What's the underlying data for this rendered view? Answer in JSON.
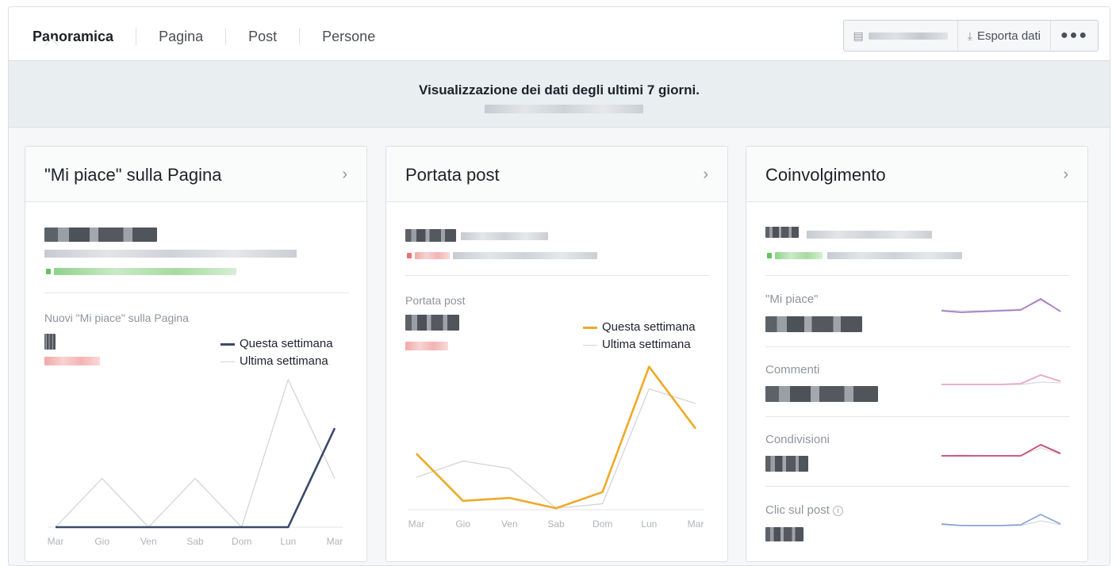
{
  "tabs": [
    {
      "label": "Panoramica",
      "active": true
    },
    {
      "label": "Pagina",
      "active": false
    },
    {
      "label": "Post",
      "active": false
    },
    {
      "label": "Persone",
      "active": false
    }
  ],
  "toolbar": {
    "date_icon": "calendar-icon",
    "export_label": "Esporta dati",
    "export_icon": "download-icon",
    "more_label": "●●●"
  },
  "banner": {
    "title": "Visualizzazione dei dati degli ultimi 7 giorni."
  },
  "cards": {
    "likes": {
      "title": "\"Mi piace\" sulla Pagina",
      "chart_label": "Nuovi \"Mi piace\" sulla Pagina",
      "legend_this": "Questa settimana",
      "legend_last": "Ultima settimana"
    },
    "reach": {
      "title": "Portata post",
      "chart_label": "Portata post",
      "legend_this": "Questa settimana",
      "legend_last": "Ultima settimana"
    },
    "engagement": {
      "title": "Coinvolgimento",
      "rows": [
        {
          "label": "\"Mi piace\"",
          "color": "#a77bc4"
        },
        {
          "label": "Commenti",
          "color": "#e8a6c8"
        },
        {
          "label": "Condivisioni",
          "color": "#c6486f"
        },
        {
          "label": "Clic sul post",
          "color": "#8ea3d8"
        }
      ]
    }
  },
  "colors": {
    "likes_this_week": "#3b4a6b",
    "reach_this_week": "#f0a92b",
    "last_week": "#d3d5d9"
  },
  "chart_data": [
    {
      "type": "line",
      "title": "Nuovi \"Mi piace\" sulla Pagina",
      "categories": [
        "Mar",
        "Gio",
        "Ven",
        "Sab",
        "Dom",
        "Lun",
        "Mar"
      ],
      "series": [
        {
          "name": "Questa settimana",
          "values": [
            0,
            0,
            0,
            0,
            0,
            0,
            6.5
          ]
        },
        {
          "name": "Ultima settimana",
          "values": [
            0,
            3.2,
            0,
            3.2,
            0,
            9.7,
            3.2
          ]
        }
      ],
      "ylim": [
        0,
        10
      ],
      "grid": false
    },
    {
      "type": "line",
      "title": "Portata post",
      "categories": [
        "Mar",
        "Gio",
        "Ven",
        "Sab",
        "Dom",
        "Lun",
        "Mar"
      ],
      "series": [
        {
          "name": "Questa settimana",
          "values": [
            38,
            6,
            8,
            1,
            12,
            97,
            55
          ]
        },
        {
          "name": "Ultima settimana",
          "values": [
            22,
            33,
            28,
            1,
            4,
            82,
            72
          ]
        }
      ],
      "ylim": [
        0,
        100
      ],
      "grid": false
    }
  ]
}
